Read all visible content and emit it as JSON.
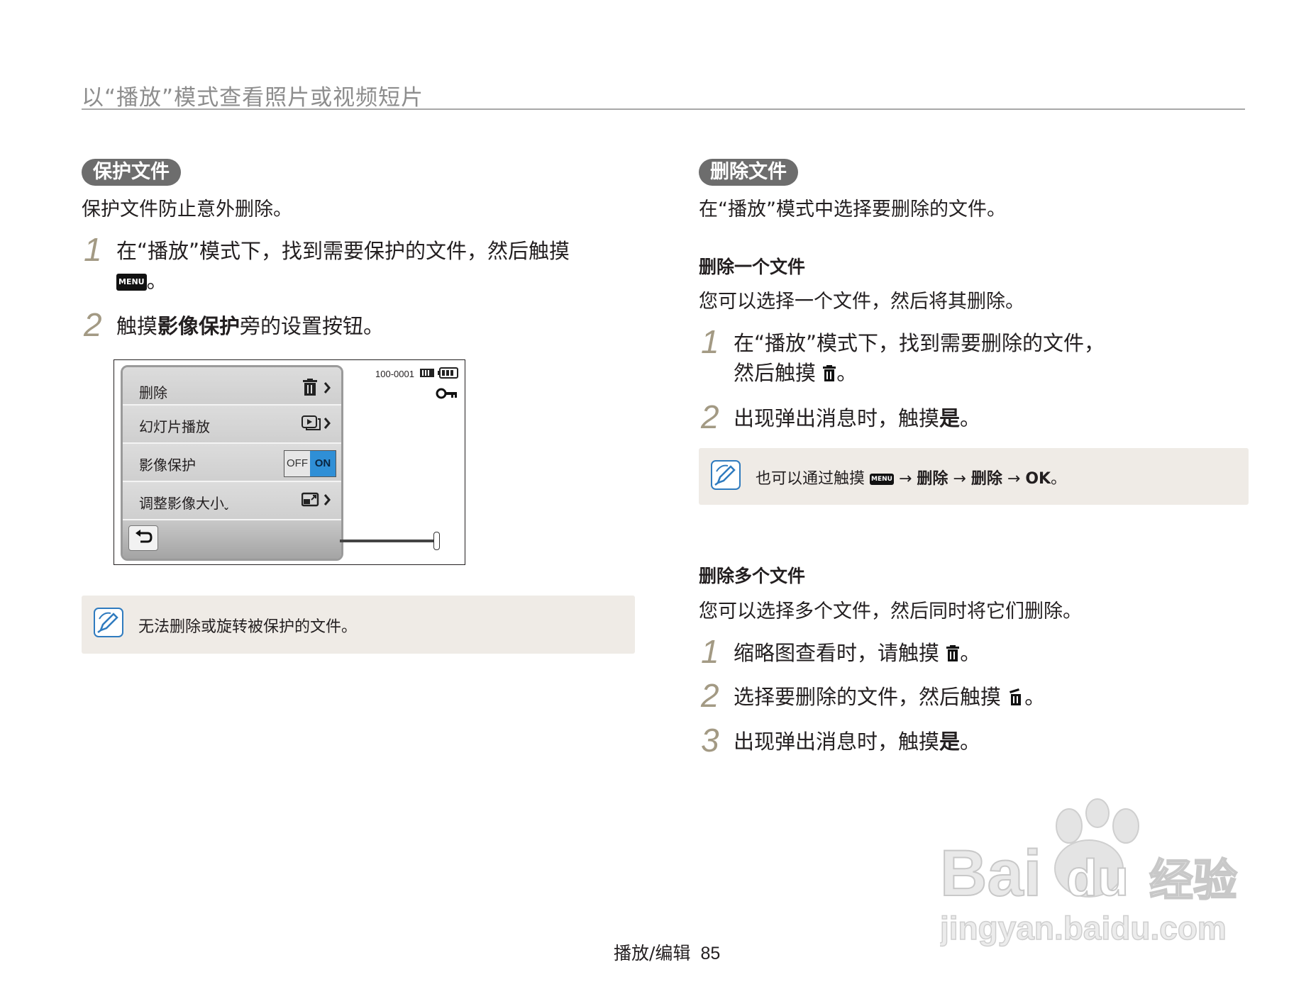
{
  "header": {
    "title": "以“播放”模式查看照片或视频短片"
  },
  "left": {
    "section_title": "保护文件",
    "intro": "保护文件防止意外删除。",
    "steps": [
      {
        "num": "1",
        "text": "在“播放”模式下，找到需要保护的文件，然后触摸",
        "cont_suffix": "。",
        "menu_key": "MENU"
      },
      {
        "num": "2",
        "pre": "触摸",
        "bold": "影像保护",
        "post": "旁的设置按钮。"
      }
    ],
    "screen": {
      "file_number": "100-0001",
      "menu_items": [
        {
          "label": "删除",
          "icon": "trash-icon"
        },
        {
          "label": "幻灯片播放",
          "icon": "slideshow-icon"
        },
        {
          "label": "影像保护",
          "toggle_off": "OFF",
          "toggle_on": "ON",
          "toggle_state": "ON"
        },
        {
          "label": "调整影像大小",
          "icon": "resize-icon"
        }
      ],
      "status_icons": [
        "card-icon",
        "battery-icon",
        "key-icon"
      ],
      "back_icon": "back-arrow-icon"
    },
    "note": "无法删除或旋转被保护的文件。"
  },
  "right": {
    "section_title": "删除文件",
    "intro": "在“播放”模式中选择要删除的文件。",
    "single": {
      "heading": "删除一个文件",
      "desc": "您可以选择一个文件，然后将其删除。",
      "steps": [
        {
          "num": "1",
          "line1": "在“播放”模式下，找到需要删除的文件，",
          "line2_pre": "然后触摸",
          "line2_post": "。"
        },
        {
          "num": "2",
          "pre": "出现弹出消息时，触摸",
          "bold": "是",
          "post": "。"
        }
      ],
      "note": {
        "pre": "也可以通过触摸",
        "menu_key": "MENU",
        "arrow1": "→",
        "item1": "删除",
        "arrow2": "→",
        "item2": "删除",
        "arrow3": "→",
        "item3": "OK",
        "post": "。"
      }
    },
    "multiple": {
      "heading": "删除多个文件",
      "desc": "您可以选择多个文件，然后同时将它们删除。",
      "steps": [
        {
          "num": "1",
          "pre": "缩略图查看时，请触摸",
          "post": "。"
        },
        {
          "num": "2",
          "pre": "选择要删除的文件，然后触摸",
          "post": "。"
        },
        {
          "num": "3",
          "pre": "出现弹出消息时，触摸",
          "bold": "是",
          "post": "。"
        }
      ]
    }
  },
  "footer": {
    "section": "播放/编辑",
    "page": "85"
  },
  "watermark": {
    "brand": "Bai",
    "brand2": "du",
    "cn": "经验",
    "url": "jingyan.baidu.com"
  }
}
